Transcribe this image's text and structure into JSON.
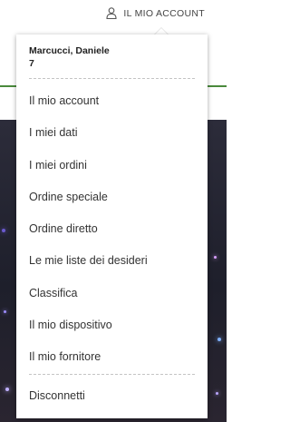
{
  "header": {
    "account_label": "IL MIO ACCOUNT",
    "account_icon": "user-icon"
  },
  "dropdown": {
    "user_name": "Marcucci, Daniele",
    "user_number": "7",
    "menu_items": [
      {
        "label": "Il mio account"
      },
      {
        "label": "I miei dati"
      },
      {
        "label": "I miei ordini"
      },
      {
        "label": "Ordine speciale"
      },
      {
        "label": "Ordine diretto"
      },
      {
        "label": "Le mie liste dei desideri"
      },
      {
        "label": "Classifica"
      },
      {
        "label": "Il mio dispositivo"
      },
      {
        "label": "Il mio fornitore"
      }
    ],
    "logout_label": "Disconnetti"
  },
  "colors": {
    "accent_green": "#4a8a3c",
    "background_dark": "#1e1f2b",
    "text": "#333333"
  }
}
